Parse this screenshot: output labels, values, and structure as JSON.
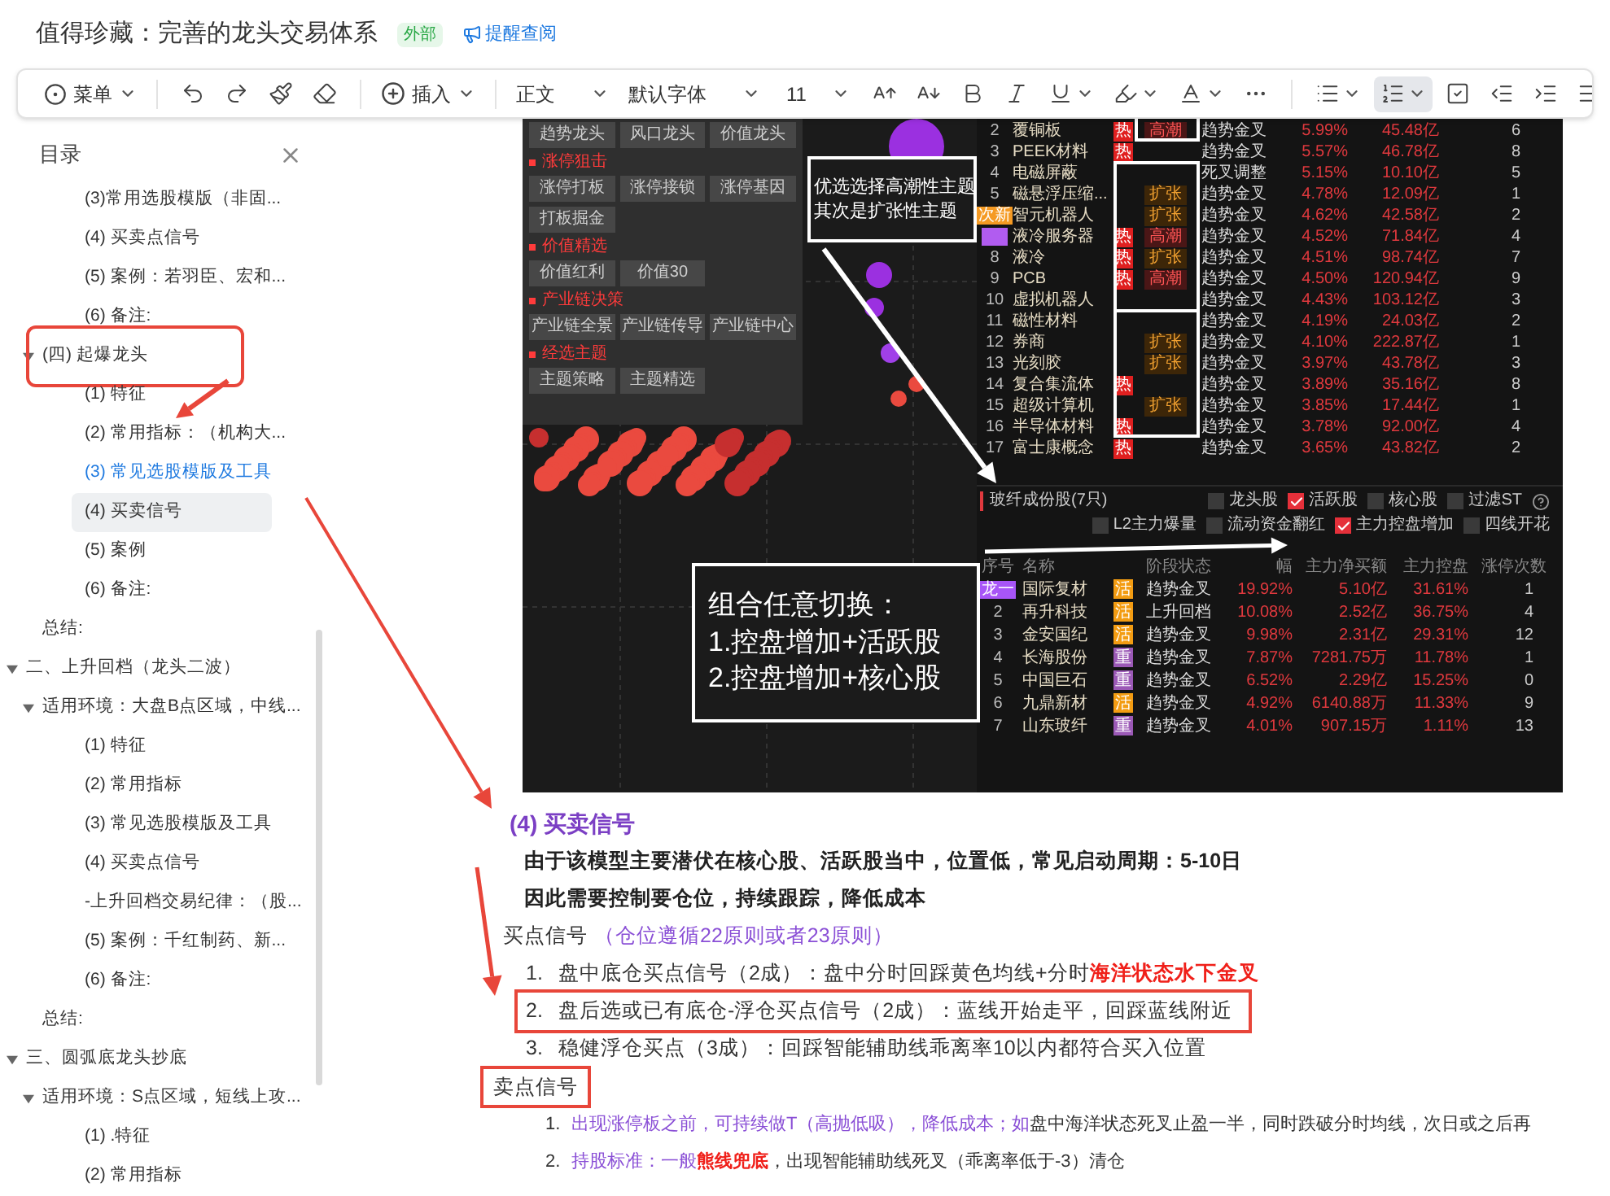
{
  "header": {
    "title": "值得珍藏：完善的龙头交易体系",
    "badge": "外部",
    "link": "提醒查阅"
  },
  "toolbar": {
    "menu": "菜单",
    "insert": "插入",
    "paragraph_style": "正文",
    "font": "默认字体",
    "font_size": "11",
    "numbered_list_active": true
  },
  "sidebar": {
    "title": "目录",
    "items": [
      {
        "children": [
          {
            "children": [
              {
                "label": "(3)常用选股模版（非固...",
                "selected": false,
                "hovered": false,
                "annotated": false
              },
              {
                "label": "(4)  买卖点信号",
                "selected": false,
                "hovered": false,
                "annotated": false
              },
              {
                "label": "(5)  案例：若羽臣、宏和...",
                "selected": false,
                "hovered": false,
                "annotated": false
              },
              {
                "label": "(6)  备注:",
                "selected": false,
                "hovered": false,
                "annotated": false
              }
            ]
          },
          {
            "label": "(四)  起爆龙头",
            "expanded": true,
            "selected": false,
            "hovered": false,
            "annotated": true,
            "children": [
              {
                "label": "(1)  特征",
                "selected": false,
                "hovered": false,
                "annotated": false
              },
              {
                "label": "(2)  常用指标：（机构大...",
                "selected": false,
                "hovered": false,
                "annotated": false
              },
              {
                "label": "(3)  常见选股模版及工具",
                "selected": true,
                "hovered": false,
                "annotated": false
              },
              {
                "label": "(4)  买卖信号",
                "selected": false,
                "hovered": true,
                "annotated": false
              },
              {
                "label": "(5)  案例",
                "selected": false,
                "hovered": false,
                "annotated": false
              },
              {
                "label": "(6)  备注:",
                "selected": false,
                "hovered": false,
                "annotated": false
              }
            ]
          },
          {
            "label": "总结:",
            "selected": false,
            "hovered": false,
            "annotated": false
          }
        ]
      },
      {
        "label": "二、上升回档（龙头二波）",
        "expanded": true,
        "selected": false,
        "hovered": false,
        "annotated": false,
        "children": [
          {
            "label": "适用环境：大盘B点区域，中线...",
            "expanded": true,
            "selected": false,
            "hovered": false,
            "annotated": false,
            "children": [
              {
                "label": "(1)  特征",
                "selected": false,
                "hovered": false,
                "annotated": false
              },
              {
                "label": "(2)  常用指标",
                "selected": false,
                "hovered": false,
                "annotated": false
              },
              {
                "label": "(3)  常见选股模版及工具",
                "selected": false,
                "hovered": false,
                "annotated": false
              },
              {
                "label": "(4)  买卖点信号",
                "selected": false,
                "hovered": false,
                "annotated": false
              },
              {
                "label": "-上升回档交易纪律：（股...",
                "selected": false,
                "hovered": false,
                "annotated": false
              },
              {
                "label": "(5)  案例：千红制药、新...",
                "selected": false,
                "hovered": false,
                "annotated": false
              },
              {
                "label": "(6)  备注:",
                "selected": false,
                "hovered": false,
                "annotated": false
              }
            ]
          },
          {
            "label": "总结:",
            "selected": false,
            "hovered": false,
            "annotated": false
          }
        ]
      },
      {
        "label": "三、圆弧底龙头抄底",
        "expanded": true,
        "selected": false,
        "hovered": false,
        "annotated": false,
        "children": [
          {
            "label": "适用环境：S点区域，短线上攻...",
            "expanded": true,
            "selected": false,
            "hovered": false,
            "annotated": false,
            "children": [
              {
                "label": "(1)  .特征",
                "selected": false,
                "hovered": false,
                "annotated": false
              },
              {
                "label": "(2)  常用指标",
                "selected": false,
                "hovered": false,
                "annotated": false
              }
            ]
          }
        ]
      }
    ]
  },
  "figure": {
    "menu_sections": [
      {
        "buttons": [
          "趋势龙头",
          "风口龙头",
          "价值龙头"
        ]
      },
      {
        "title": "涨停狙击",
        "buttons": [
          "涨停打板",
          "涨停接锁",
          "涨停基因",
          "打板掘金"
        ]
      },
      {
        "title": "价值精选",
        "buttons": [
          "价值红利",
          "价值30"
        ]
      },
      {
        "title": "产业链决策",
        "buttons": [
          "产业链全景",
          "产业链传导",
          "产业链中心"
        ]
      },
      {
        "title": "经选主题",
        "buttons": [
          "主题策略",
          "主题精选"
        ]
      }
    ],
    "callouts": [
      {
        "lines": [
          "优选选择高潮性主题",
          "其次是扩张性主题"
        ]
      },
      {
        "lines": [
          "组合任意切换：",
          "1.控盘增加+活跃股",
          "2.控盘增加+核心股"
        ]
      }
    ],
    "top_table": {
      "rows": [
        {
          "num": "2",
          "name": "覆铜板",
          "hot": "热",
          "tag": {
            "kind": "peak",
            "text": "高潮"
          },
          "status": "趋势金叉",
          "change": "5.99%",
          "amount": "45.48亿",
          "count": "6"
        },
        {
          "num": "3",
          "name": "PEEK材料",
          "hot": "热",
          "status": "趋势金叉",
          "change": "5.57%",
          "amount": "46.78亿",
          "count": "8"
        },
        {
          "num": "4",
          "name": "电磁屏蔽",
          "status": "死叉调整",
          "change": "5.15%",
          "amount": "10.10亿",
          "count": "5"
        },
        {
          "num": "5",
          "name": "磁悬浮压缩...",
          "tag": {
            "kind": "expand",
            "text": "扩张"
          },
          "status": "趋势金叉",
          "change": "4.78%",
          "amount": "12.09亿",
          "count": "1"
        },
        {
          "marker": {
            "text": "次新",
            "color": "#f59a23"
          },
          "name": "智元机器人",
          "tag": {
            "kind": "expand",
            "text": "扩张"
          },
          "status": "趋势金叉",
          "change": "4.62%",
          "amount": "42.58亿",
          "count": "2"
        },
        {
          "marker": {
            "color": "#b15cf0"
          },
          "name": "液冷服务器",
          "hot": "热",
          "tag": {
            "kind": "peak",
            "text": "高潮"
          },
          "status": "趋势金叉",
          "change": "4.52%",
          "amount": "71.84亿",
          "count": "4"
        },
        {
          "num": "8",
          "name": "液冷",
          "hot": "热",
          "tag": {
            "kind": "expand",
            "text": "扩张"
          },
          "status": "趋势金叉",
          "change": "4.51%",
          "amount": "98.74亿",
          "count": "7"
        },
        {
          "num": "9",
          "name": "PCB",
          "hot": "热",
          "tag": {
            "kind": "peak",
            "text": "高潮"
          },
          "status": "趋势金叉",
          "change": "4.50%",
          "amount": "120.94亿",
          "count": "9"
        },
        {
          "num": "10",
          "name": "虚拟机器人",
          "status": "趋势金叉",
          "change": "4.43%",
          "amount": "103.12亿",
          "count": "3"
        },
        {
          "num": "11",
          "name": "磁性材料",
          "status": "趋势金叉",
          "change": "4.19%",
          "amount": "24.03亿",
          "count": "2"
        },
        {
          "num": "12",
          "name": "券商",
          "tag": {
            "kind": "expand",
            "text": "扩张"
          },
          "status": "趋势金叉",
          "change": "4.10%",
          "amount": "222.87亿",
          "count": "1"
        },
        {
          "num": "13",
          "name": "光刻胶",
          "tag": {
            "kind": "expand",
            "text": "扩张"
          },
          "status": "趋势金叉",
          "change": "3.97%",
          "amount": "43.78亿",
          "count": "3"
        },
        {
          "num": "14",
          "name": "复合集流体",
          "hot": "热",
          "status": "趋势金叉",
          "change": "3.89%",
          "amount": "35.16亿",
          "count": "8"
        },
        {
          "num": "15",
          "name": "超级计算机",
          "tag": {
            "kind": "expand",
            "text": "扩张"
          },
          "status": "趋势金叉",
          "change": "3.85%",
          "amount": "17.44亿",
          "count": "1"
        },
        {
          "num": "16",
          "name": "半导体材料",
          "hot": "热",
          "status": "趋势金叉",
          "change": "3.78%",
          "amount": "92.00亿",
          "count": "4"
        },
        {
          "num": "17",
          "name": "富士康概念",
          "hot": "热",
          "status": "趋势金叉",
          "change": "3.65%",
          "amount": "43.82亿",
          "count": "2"
        }
      ]
    },
    "stock_panel": {
      "title": "玻纤成份股(7只)",
      "filters": [
        [
          {
            "label": "龙头股",
            "checked": false
          },
          {
            "label": "活跃股",
            "checked": true
          },
          {
            "label": "核心股",
            "checked": false
          },
          {
            "label": "过滤ST",
            "checked": false
          }
        ],
        [
          {
            "label": "L2主力爆量",
            "checked": false
          },
          {
            "label": "流动资金翻红",
            "checked": false
          },
          {
            "label": "主力控盘增加",
            "checked": true
          },
          {
            "label": "四线开花",
            "checked": false
          }
        ]
      ],
      "columns": [
        "序号",
        "名称",
        "阶段状态",
        "幅",
        "主力净买额",
        "主力控盘",
        "涨停次数"
      ],
      "rows": [
        {
          "rank": "龙一",
          "name": "国际复材",
          "type": {
            "kind": "active",
            "text": "活"
          },
          "status": "趋势金叉",
          "change": "19.92%",
          "net_buy": "5.10亿",
          "control": "31.61%",
          "count": "1"
        },
        {
          "num": "2",
          "name": "再升科技",
          "type": {
            "kind": "active",
            "text": "活"
          },
          "status": "上升回档",
          "change": "10.08%",
          "net_buy": "2.52亿",
          "control": "36.75%",
          "count": "4"
        },
        {
          "num": "3",
          "name": "金安国纪",
          "type": {
            "kind": "active",
            "text": "活"
          },
          "status": "趋势金叉",
          "change": "9.98%",
          "net_buy": "2.31亿",
          "control": "29.31%",
          "count": "12"
        },
        {
          "num": "4",
          "name": "长海股份",
          "type": {
            "kind": "heavy",
            "text": "重"
          },
          "status": "趋势金叉",
          "change": "7.87%",
          "net_buy": "7281.75万",
          "control": "11.78%",
          "count": "1"
        },
        {
          "num": "5",
          "name": "中国巨石",
          "type": {
            "kind": "heavy",
            "text": "重"
          },
          "status": "趋势金叉",
          "change": "6.52%",
          "net_buy": "2.29亿",
          "control": "15.25%",
          "count": "0"
        },
        {
          "num": "6",
          "name": "九鼎新材",
          "type": {
            "kind": "active",
            "text": "活"
          },
          "status": "趋势金叉",
          "change": "4.92%",
          "net_buy": "6140.88万",
          "control": "11.33%",
          "count": "9"
        },
        {
          "num": "7",
          "name": "山东玻纤",
          "type": {
            "kind": "heavy",
            "text": "重"
          },
          "status": "趋势金叉",
          "change": "4.01%",
          "net_buy": "907.15万",
          "control": "1.11%",
          "count": "13"
        }
      ]
    }
  },
  "section": {
    "heading": "(4)  买卖信号",
    "intro": [
      "由于该模型主要潜伏在核心股、活跃股当中，位置低，常见启动周期：5-10日",
      "因此需要控制要仓位，持续跟踪，降低成本"
    ],
    "buy_label": "买点信号",
    "buy_note": "（仓位遵循22原则或者23原则）",
    "buy_items": [
      {
        "number": "1.",
        "highlighted": false,
        "segments": [
          {
            "kind": "plain",
            "text": "盘中底仓买点信号（2成）：盘中分时回踩黄色均线+分时"
          },
          {
            "kind": "alert",
            "text": "海洋状态水下金叉"
          }
        ]
      },
      {
        "number": "2.",
        "highlighted": true,
        "segments": [
          {
            "kind": "plain",
            "text": "盘后选或已有底仓-浮仓买点信号（2成）：蓝线开始走平，回踩蓝线附近"
          }
        ]
      },
      {
        "number": "3.",
        "highlighted": false,
        "segments": [
          {
            "kind": "plain",
            "text": "稳健浮仓买点（3成）：回踩智能辅助线乖离率10以内都符合买入位置"
          }
        ]
      }
    ],
    "sell_label": "卖点信号",
    "sell_label_highlighted": true,
    "sell_items": [
      {
        "number": "1.",
        "segments": [
          {
            "kind": "accent",
            "text": "出现涨停板之前，可持续做T（高抛低吸），降低成本；如"
          },
          {
            "kind": "plain",
            "text": "盘中海洋状态死叉止盈一半，同时跌破分时均线，次日或之后再"
          }
        ]
      },
      {
        "number": "2.",
        "segments": [
          {
            "kind": "accent",
            "text": "持股标准：一般"
          },
          {
            "kind": "alert",
            "text": "熊线兜底"
          },
          {
            "kind": "plain",
            "text": "，出现智能辅助线死叉（乖离率低于-3）清仓"
          }
        ]
      }
    ]
  }
}
